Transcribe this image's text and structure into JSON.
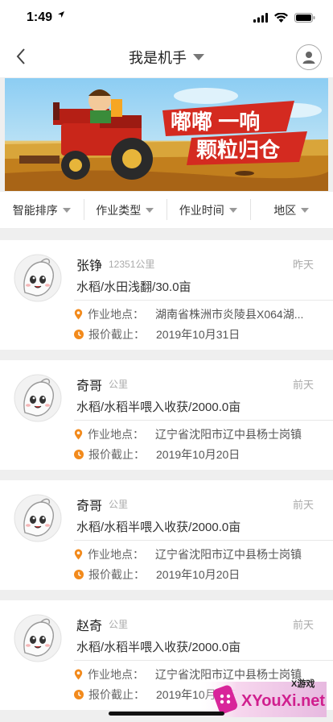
{
  "status_bar": {
    "time": "1:49"
  },
  "nav": {
    "title": "我是机手"
  },
  "banner": {
    "line1": "嘟嘟 一响",
    "line2": "颗粒归仓"
  },
  "filters": [
    {
      "label": "智能排序"
    },
    {
      "label": "作业类型"
    },
    {
      "label": "作业时间"
    },
    {
      "label": "地区"
    }
  ],
  "labels": {
    "location": "作业地点：",
    "deadline": "报价截止："
  },
  "cards": [
    {
      "name": "张铮",
      "distance": "12351公里",
      "when": "昨天",
      "crop": "水稻/水田浅翻/30.0亩",
      "location": "湖南省株洲市炎陵县X064湖...",
      "deadline": "2019年10月31日"
    },
    {
      "name": "奇哥",
      "distance": "公里",
      "when": "前天",
      "crop": "水稻/水稻半喂入收获/2000.0亩",
      "location": "辽宁省沈阳市辽中县杨士岗镇",
      "deadline": "2019年10月20日"
    },
    {
      "name": "奇哥",
      "distance": "公里",
      "when": "前天",
      "crop": "水稻/水稻半喂入收获/2000.0亩",
      "location": "辽宁省沈阳市辽中县杨士岗镇",
      "deadline": "2019年10月20日"
    },
    {
      "name": "赵奇",
      "distance": "公里",
      "when": "前天",
      "crop": "水稻/水稻半喂入收获/2000.0亩",
      "location": "辽宁省沈阳市辽中县杨士岗镇",
      "deadline": "2019年10月20日"
    }
  ],
  "watermark": {
    "brand": "XYouXi.net",
    "sub": "X游戏"
  },
  "colors": {
    "accent": "#f28a1c",
    "banner_red": "#d42a20"
  }
}
